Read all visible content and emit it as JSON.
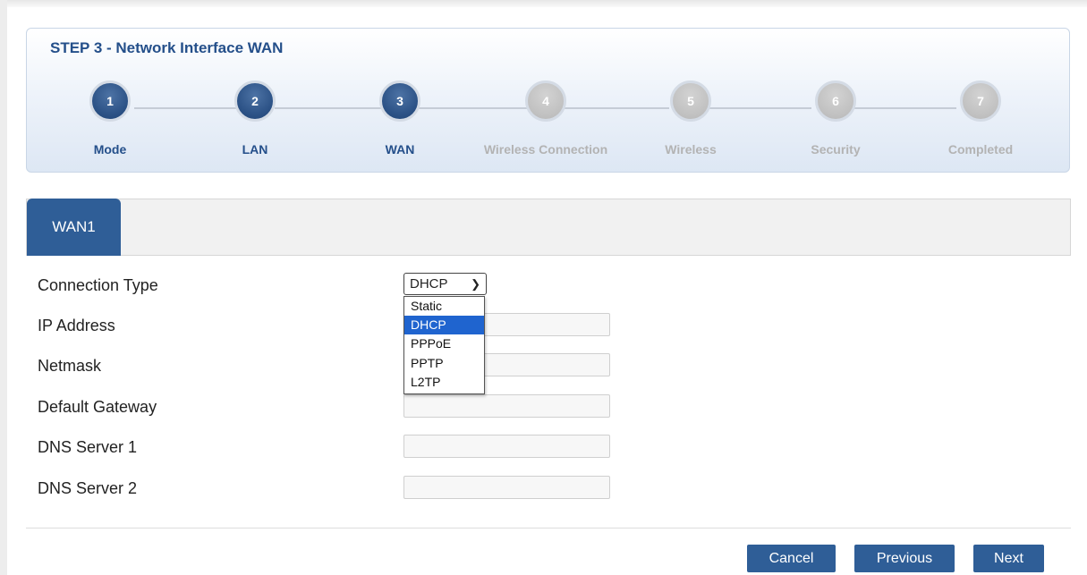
{
  "wizard": {
    "title": "STEP 3 - Network Interface WAN",
    "steps": [
      {
        "number": "1",
        "label": "Mode",
        "state": "done"
      },
      {
        "number": "2",
        "label": "LAN",
        "state": "done"
      },
      {
        "number": "3",
        "label": "WAN",
        "state": "done"
      },
      {
        "number": "4",
        "label": "Wireless Connection",
        "state": "todo"
      },
      {
        "number": "5",
        "label": "Wireless",
        "state": "todo"
      },
      {
        "number": "6",
        "label": "Security",
        "state": "todo"
      },
      {
        "number": "7",
        "label": "Completed",
        "state": "todo"
      }
    ]
  },
  "tabs": {
    "active": "WAN1"
  },
  "form": {
    "connection_type_label": "Connection Type",
    "connection_type_value": "DHCP",
    "options": [
      "Static",
      "DHCP",
      "PPPoE",
      "PPTP",
      "L2TP"
    ],
    "fields": {
      "ip_address": {
        "label": "IP Address",
        "value": ""
      },
      "netmask": {
        "label": "Netmask",
        "value": ""
      },
      "default_gateway": {
        "label": "Default Gateway",
        "value": ""
      },
      "dns1": {
        "label": "DNS Server 1",
        "value": ""
      },
      "dns2": {
        "label": "DNS Server 2",
        "value": ""
      }
    }
  },
  "buttons": {
    "cancel": "Cancel",
    "previous": "Previous",
    "next": "Next"
  },
  "colors": {
    "primary": "#2f5e97",
    "title": "#244f8a",
    "selected_option": "#1f64cf",
    "inactive_step": "#c0c0c0"
  }
}
